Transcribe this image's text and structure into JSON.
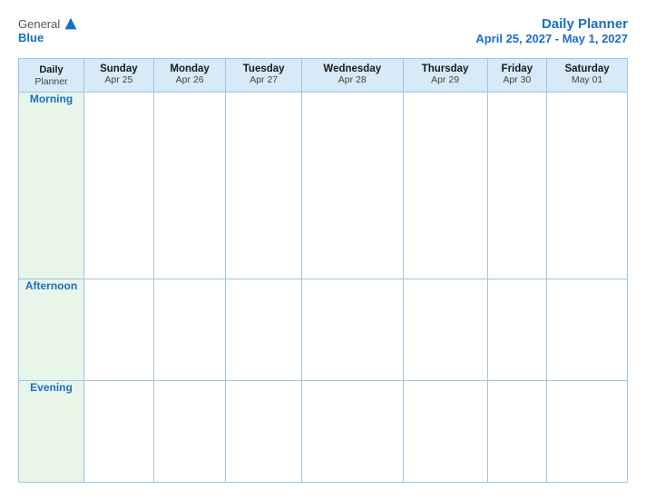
{
  "header": {
    "logo": {
      "general": "General",
      "blue": "Blue",
      "icon_title": "GeneralBlue logo"
    },
    "title": "Daily Planner",
    "date_range": "April 25, 2027 - May 1, 2027"
  },
  "table": {
    "label_header": {
      "line1": "Daily",
      "line2": "Planner"
    },
    "columns": [
      {
        "day": "Sunday",
        "date": "Apr 25"
      },
      {
        "day": "Monday",
        "date": "Apr 26"
      },
      {
        "day": "Tuesday",
        "date": "Apr 27"
      },
      {
        "day": "Wednesday",
        "date": "Apr 28"
      },
      {
        "day": "Thursday",
        "date": "Apr 29"
      },
      {
        "day": "Friday",
        "date": "Apr 30"
      },
      {
        "day": "Saturday",
        "date": "May 01"
      }
    ],
    "rows": [
      {
        "label": "Morning"
      },
      {
        "label": "Afternoon"
      },
      {
        "label": "Evening"
      }
    ]
  }
}
